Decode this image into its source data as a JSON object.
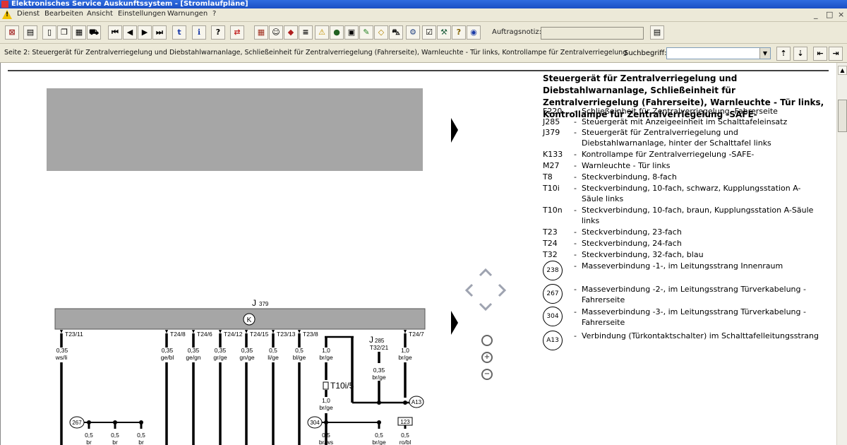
{
  "window": {
    "title": "Elektronisches Service Auskunftssystem - [Stromlaufpläne]",
    "controls": [
      "_",
      "□",
      "×"
    ]
  },
  "menu": [
    "Dienst",
    "Bearbeiten",
    "Ansicht",
    "Einstellungen",
    "Warnungen",
    "?"
  ],
  "toolbar": {
    "order_label": "Auftragsnotiz:",
    "order_value": ""
  },
  "infobar": {
    "page_text": "Seite 2: Steuergerät für Zentralverriegelung und Diebstahlwarnanlage, Schließeinheit für Zentralverriegelung (Fahrerseite), Warnleuchte - Tür links, Kontrollampe für Zentralverriegelung",
    "search_label": "Suchbegriff:",
    "search_value": ""
  },
  "diagram": {
    "control_unit": "J",
    "control_unit_sub": "379",
    "j285_label": "J",
    "j285_sub": "285",
    "j285_pin": "T32/21",
    "pins": [
      "T23/11",
      "T24/8",
      "T24/6",
      "T24/12",
      "T24/15",
      "T23/13",
      "T23/8",
      "T24/7"
    ],
    "wire_sizes": [
      "0,35",
      "0,35",
      "0,35",
      "0,35",
      "0,35",
      "0,5",
      "0,5",
      "1,0",
      "1,0"
    ],
    "wire_colors": [
      "ws/li",
      "ge/bl",
      "ge/gn",
      "gr/ge",
      "gn/ge",
      "li/ge",
      "bl/ge",
      "br/ge",
      "br/ge"
    ],
    "t10": "T10i/5",
    "mid_wire_size": "1,0",
    "mid_wire_color": "br/ge",
    "j285_wire_size": "0,35",
    "j285_wire_color": "br/ge",
    "node_a13": "A13",
    "node_267": "267",
    "node_304": "304",
    "node_123": "123",
    "bottom_sizes": [
      "0,5",
      "0,5",
      "0,5",
      "0,5",
      "0,5",
      "0,5"
    ],
    "bottom_colors": [
      "br",
      "br",
      "br",
      "br/ws",
      "br/ge",
      "ro/bl"
    ]
  },
  "legend": {
    "title": "Steuergerät für Zentralverriegelung und Diebstahlwarnanlage, Schließeinheit für Zentralverriegelung (Fahrerseite), Warnleuchte - Tür links, Kontrollampe für Zentralverriegelung -SAFE-",
    "items": [
      {
        "code": "F220",
        "desc": "Schließeinheit für Zentralverriegelung, Fahrerseite"
      },
      {
        "code": "J285",
        "desc": "Steuergerät mit Anzeigeeinheit im Schalttafeleinsatz"
      },
      {
        "code": "J379",
        "desc": "Steuergerät für Zentralverriegelung und Diebstahlwarnanlage, hinter der Schalttafel links"
      },
      {
        "code": "K133",
        "desc": "Kontrollampe für Zentralverriegelung -SAFE-"
      },
      {
        "code": "M27",
        "desc": "Warnleuchte - Tür links"
      },
      {
        "code": "T8",
        "desc": "Steckverbindung, 8-fach"
      },
      {
        "code": "T10i",
        "desc": "Steckverbindung, 10-fach, schwarz, Kupplungsstation A-Säule links"
      },
      {
        "code": "T10n",
        "desc": "Steckverbindung, 10-fach, braun, Kupplungsstation A-Säule links"
      },
      {
        "code": "T23",
        "desc": "Steckverbindung, 23-fach"
      },
      {
        "code": "T24",
        "desc": "Steckverbindung, 24-fach"
      },
      {
        "code": "T32",
        "desc": "Steckverbindung, 32-fach, blau"
      }
    ],
    "circles": [
      {
        "code": "238",
        "desc": "Masseverbindung -1-, im Leitungsstrang Innenraum"
      },
      {
        "code": "267",
        "desc": "Masseverbindung -2-, im Leitungsstrang Türverkabelung - Fahrerseite"
      },
      {
        "code": "304",
        "desc": "Masseverbindung -3-, im Leitungsstrang Türverkabelung - Fahrerseite"
      },
      {
        "code": "A13",
        "desc": "Verbindung (Türkontaktschalter) im Schalttafelleitungsstrang"
      }
    ]
  }
}
